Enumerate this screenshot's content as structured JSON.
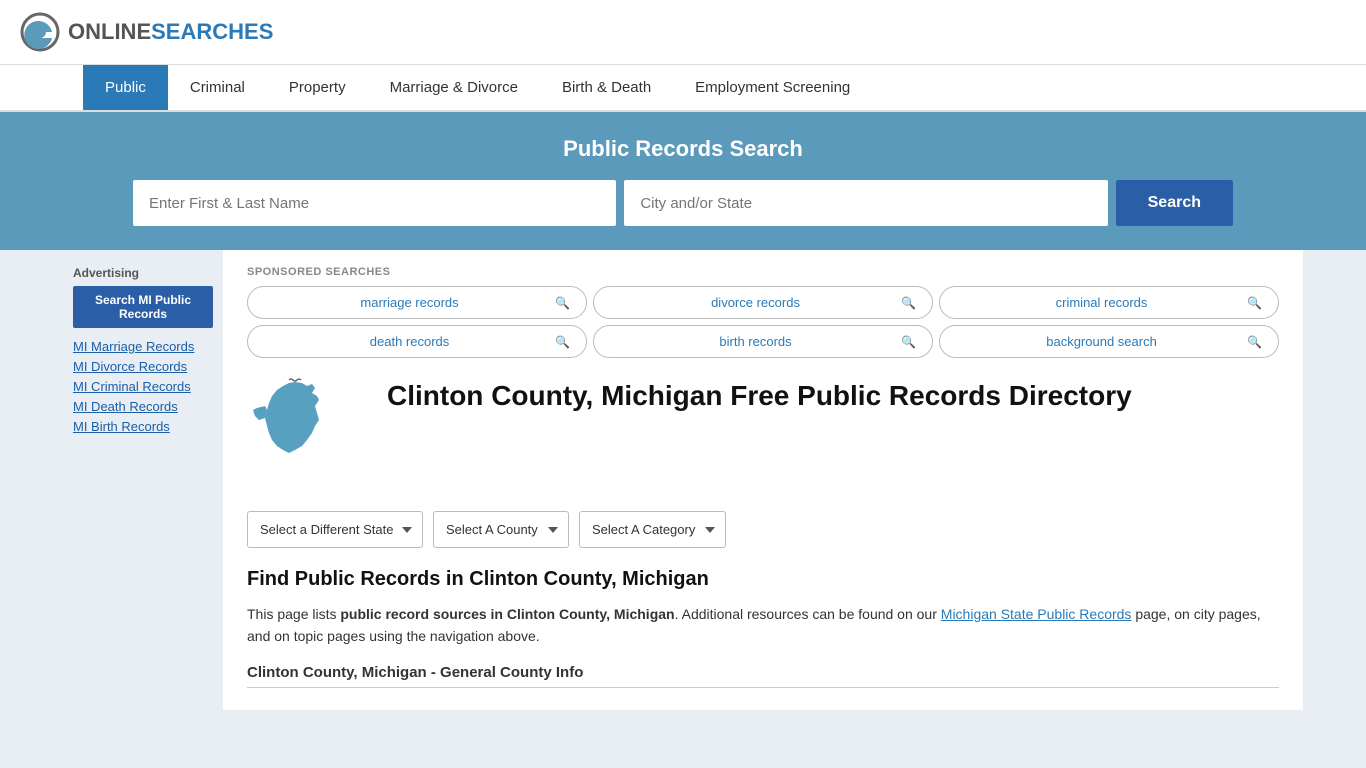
{
  "header": {
    "logo_text_online": "ONLINE",
    "logo_text_searches": "SEARCHES"
  },
  "nav": {
    "items": [
      {
        "label": "Public",
        "active": true
      },
      {
        "label": "Criminal",
        "active": false
      },
      {
        "label": "Property",
        "active": false
      },
      {
        "label": "Marriage & Divorce",
        "active": false
      },
      {
        "label": "Birth & Death",
        "active": false
      },
      {
        "label": "Employment Screening",
        "active": false
      }
    ]
  },
  "hero": {
    "title": "Public Records Search",
    "name_placeholder": "Enter First & Last Name",
    "location_placeholder": "City and/or State",
    "search_button": "Search"
  },
  "sponsored": {
    "label": "SPONSORED SEARCHES",
    "items": [
      {
        "text": "marriage records"
      },
      {
        "text": "divorce records"
      },
      {
        "text": "criminal records"
      },
      {
        "text": "death records"
      },
      {
        "text": "birth records"
      },
      {
        "text": "background search"
      }
    ]
  },
  "page": {
    "title": "Clinton County, Michigan Free Public Records Directory",
    "find_title": "Find Public Records in Clinton County, Michigan",
    "find_text_1": "This page lists ",
    "find_text_bold": "public record sources in Clinton County, Michigan",
    "find_text_2": ". Additional resources can be found on our ",
    "find_link": "Michigan State Public Records",
    "find_text_3": " page, on city pages, and on topic pages using the navigation above.",
    "general_info_header": "Clinton County, Michigan - General County Info"
  },
  "dropdowns": {
    "state": {
      "label": "Select a Different State",
      "options": [
        "Select a Different State"
      ]
    },
    "county": {
      "label": "Select A County",
      "options": [
        "Select A County"
      ]
    },
    "category": {
      "label": "Select A Category",
      "options": [
        "Select A Category"
      ]
    }
  },
  "sidebar": {
    "ad_label": "Advertising",
    "ad_button": "Search MI Public Records",
    "links": [
      {
        "text": "MI Marriage Records"
      },
      {
        "text": "MI Divorce Records"
      },
      {
        "text": "MI Criminal Records"
      },
      {
        "text": "MI Death Records"
      },
      {
        "text": "MI Birth Records"
      }
    ]
  }
}
